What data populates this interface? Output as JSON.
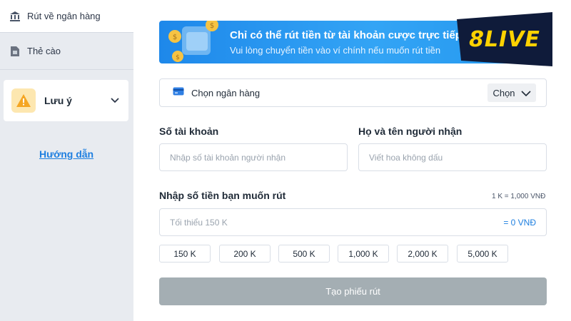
{
  "sidebar": {
    "items": [
      {
        "label": "Rút về ngân hàng",
        "icon": "bank-icon"
      },
      {
        "label": "Thẻ cào",
        "icon": "sim-card-icon"
      }
    ],
    "note": {
      "label": "Lưu ý",
      "icon": "warning-icon"
    },
    "guide_link": "Hướng dẫn"
  },
  "banner": {
    "title": "Chỉ có thể rút tiền từ tài khoản cược trực tiếp",
    "subtitle": "Vui lòng chuyển tiền vào ví chính nếu muốn rút tiền",
    "logo": "8LIVE"
  },
  "bank_select": {
    "label": "Chọn ngân hàng",
    "button": "Chọn"
  },
  "account": {
    "label": "Số tài khoản",
    "placeholder": "Nhập số tài khoản người nhận"
  },
  "recipient": {
    "label": "Họ và tên người nhận",
    "placeholder": "Viết hoa không dấu"
  },
  "amount": {
    "label": "Nhập số tiền bạn muốn rút",
    "rate": "1 K = 1,000 VNĐ",
    "placeholder": "Tối thiểu 150 K",
    "equals": "= 0 VNĐ"
  },
  "quick_amounts": [
    "150 K",
    "200 K",
    "500 K",
    "1,000 K",
    "2,000 K",
    "5,000 K"
  ],
  "submit": "Tạo phiếu rút",
  "colors": {
    "accent": "#1e7fe0",
    "banner": "#2296ee",
    "disabled": "#a4aeb3",
    "logo": "#ffd200"
  }
}
